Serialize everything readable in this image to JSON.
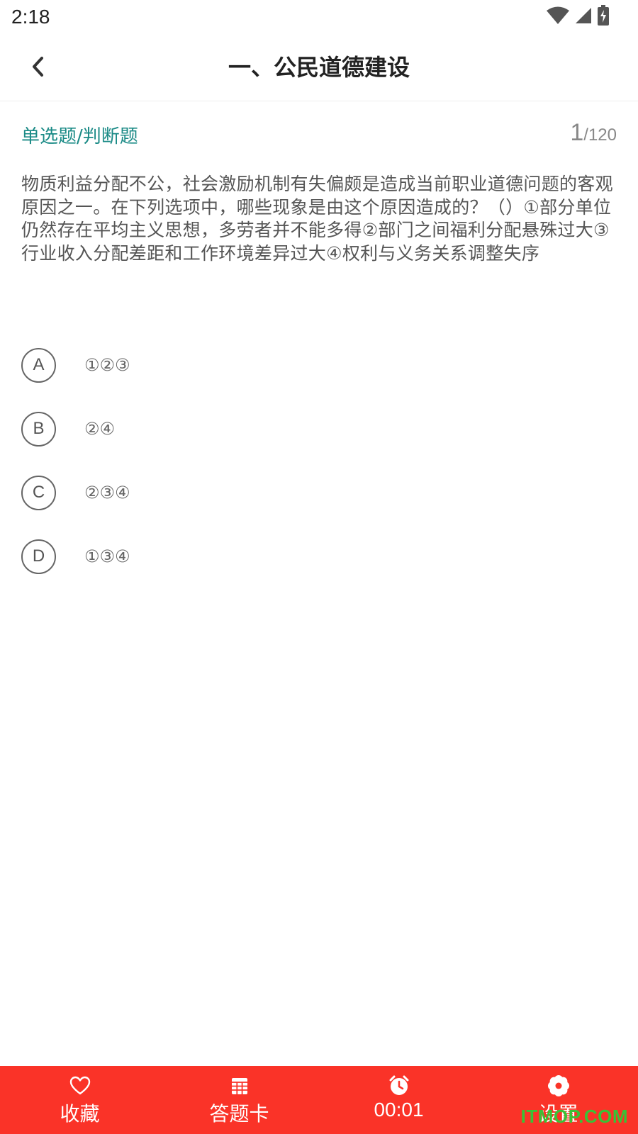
{
  "status_bar": {
    "time": "2:18",
    "icons": [
      "wifi-icon",
      "signal-icon",
      "battery-charging-icon"
    ]
  },
  "header": {
    "title": "一、公民道德建设",
    "back_icon": "chevron-left-icon"
  },
  "question": {
    "type": "单选题/判断题",
    "current": "1",
    "total": "/120",
    "text": "物质利益分配不公，社会激励机制有失偏颇是造成当前职业道德问题的客观原因之一。在下列选项中，哪些现象是由这个原因造成的？（）①部分单位仍然存在平均主义思想，多劳者并不能多得②部门之间福利分配悬殊过大③行业收入分配差距和工作环境差异过大④权利与义务关系调整失序"
  },
  "options": [
    {
      "letter": "A",
      "text": "①②③"
    },
    {
      "letter": "B",
      "text": "②④"
    },
    {
      "letter": "C",
      "text": "②③④"
    },
    {
      "letter": "D",
      "text": "①③④"
    }
  ],
  "bottom_bar": {
    "favorite_label": "收藏",
    "answer_card_label": "答题卡",
    "timer_label": "00:01",
    "settings_label": "设置"
  },
  "watermark": "ITMOP.COM",
  "colors": {
    "accent_teal": "#1a8a86",
    "bottom_bar_red": "#fa3328",
    "watermark_green": "#39c236"
  }
}
